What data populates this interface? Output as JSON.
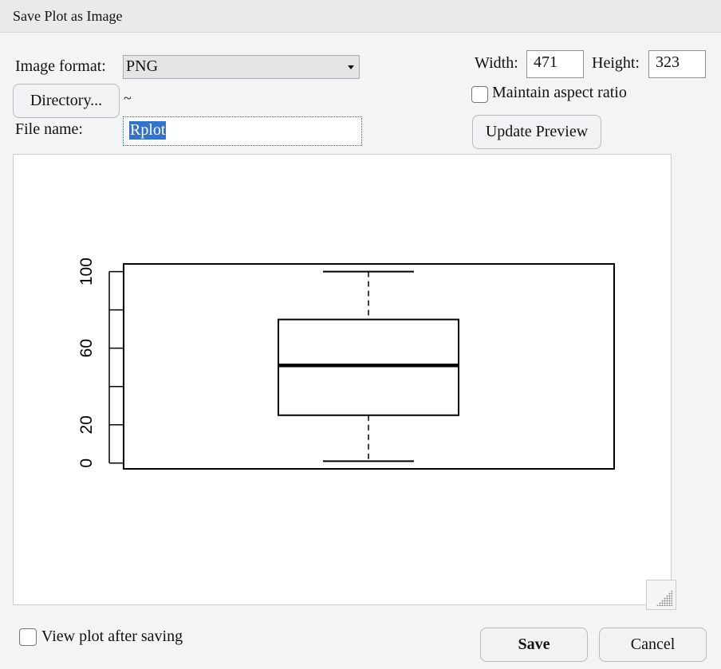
{
  "dialog": {
    "title": "Save Plot as Image"
  },
  "format": {
    "label": "Image format:",
    "value": "PNG"
  },
  "directory": {
    "button_label": "Directory...",
    "path": "~"
  },
  "filename": {
    "label": "File name:",
    "value": "Rplot"
  },
  "size": {
    "width_label": "Width:",
    "width_value": "471",
    "height_label": "Height:",
    "height_value": "323",
    "aspect_label": "Maintain aspect ratio",
    "aspect_checked": false
  },
  "update_preview_label": "Update Preview",
  "view_after_label": "View plot after saving",
  "view_after_checked": false,
  "save_label": "Save",
  "cancel_label": "Cancel",
  "chart_data": {
    "type": "boxplot",
    "y_ticks": [
      0,
      20,
      40,
      60,
      80,
      100
    ],
    "y_tick_labels": [
      "0",
      "20",
      "60",
      "100"
    ],
    "ylim": [
      -3,
      104
    ],
    "stats": {
      "min": 1,
      "q1": 25,
      "median": 51,
      "q3": 75,
      "max": 100
    },
    "title": "",
    "xlabel": "",
    "ylabel": ""
  }
}
